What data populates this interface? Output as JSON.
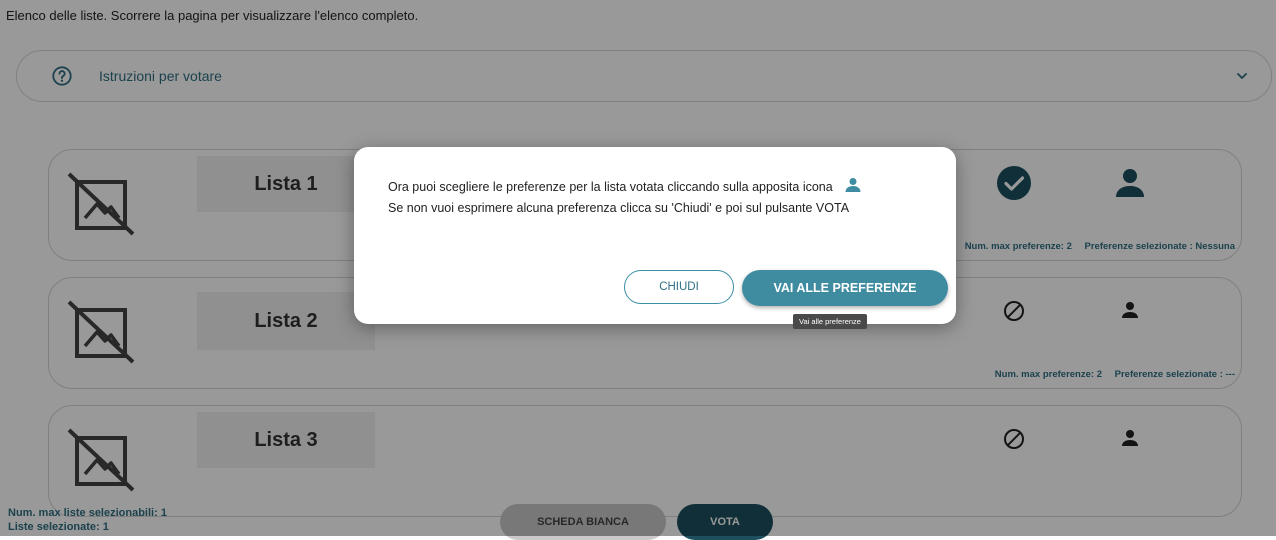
{
  "intro_text": "Elenco delle liste. Scorrere la pagina per visualizzare l'elenco completo.",
  "instructions": {
    "label": "Istruzioni per votare",
    "icon": "help-circle-icon",
    "expand_icon": "chevron-down-icon"
  },
  "lists": [
    {
      "name": "Lista 1",
      "vote_status": "selected",
      "max_pref_label": "Num. max preferenze: 2",
      "selected_pref_label": "Preferenze selezionate : Nessuna"
    },
    {
      "name": "Lista 2",
      "vote_status": "not-selected",
      "max_pref_label": "Num. max preferenze: 2",
      "selected_pref_label": "Preferenze selezionate : ---"
    },
    {
      "name": "Lista 3",
      "vote_status": "not-selected",
      "max_pref_label": "",
      "selected_pref_label": ""
    }
  ],
  "footer": {
    "max_lists": "Num. max liste selezionabili: 1",
    "selected_lists": "Liste selezionate: 1",
    "blank_ballot_label": "SCHEDA BIANCA",
    "vote_label": "VOTA"
  },
  "dialog": {
    "line1": "Ora puoi scegliere le preferenze per la lista votata cliccando sulla apposita icona",
    "line2": "Se non vuoi esprimere alcuna preferenza clicca su 'Chiudi' e poi sul pulsante VOTA",
    "close_label": "CHIUDI",
    "preferences_label": "VAI ALLE PREFERENZE",
    "tooltip": "Vai alle preferenze"
  },
  "colors": {
    "accent": "#3f8ca1",
    "dark_accent": "#1d4f5e",
    "text_accent": "#2f6f82"
  }
}
